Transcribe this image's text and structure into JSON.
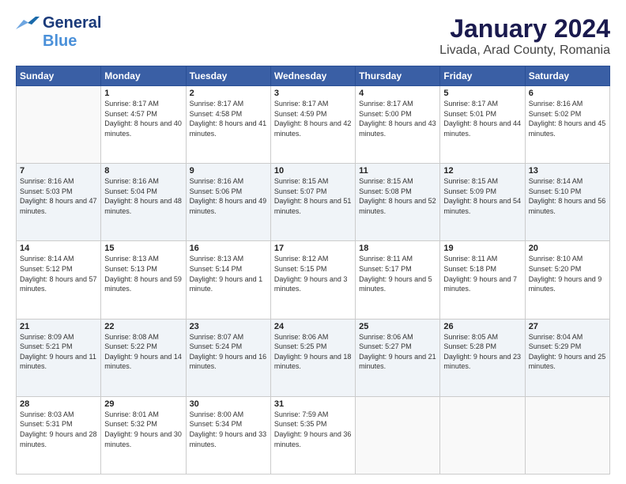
{
  "logo": {
    "line1": "General",
    "line2": "Blue"
  },
  "title": "January 2024",
  "subtitle": "Livada, Arad County, Romania",
  "headers": [
    "Sunday",
    "Monday",
    "Tuesday",
    "Wednesday",
    "Thursday",
    "Friday",
    "Saturday"
  ],
  "weeks": [
    [
      {
        "day": "",
        "sunrise": "",
        "sunset": "",
        "daylight": ""
      },
      {
        "day": "1",
        "sunrise": "Sunrise: 8:17 AM",
        "sunset": "Sunset: 4:57 PM",
        "daylight": "Daylight: 8 hours and 40 minutes."
      },
      {
        "day": "2",
        "sunrise": "Sunrise: 8:17 AM",
        "sunset": "Sunset: 4:58 PM",
        "daylight": "Daylight: 8 hours and 41 minutes."
      },
      {
        "day": "3",
        "sunrise": "Sunrise: 8:17 AM",
        "sunset": "Sunset: 4:59 PM",
        "daylight": "Daylight: 8 hours and 42 minutes."
      },
      {
        "day": "4",
        "sunrise": "Sunrise: 8:17 AM",
        "sunset": "Sunset: 5:00 PM",
        "daylight": "Daylight: 8 hours and 43 minutes."
      },
      {
        "day": "5",
        "sunrise": "Sunrise: 8:17 AM",
        "sunset": "Sunset: 5:01 PM",
        "daylight": "Daylight: 8 hours and 44 minutes."
      },
      {
        "day": "6",
        "sunrise": "Sunrise: 8:16 AM",
        "sunset": "Sunset: 5:02 PM",
        "daylight": "Daylight: 8 hours and 45 minutes."
      }
    ],
    [
      {
        "day": "7",
        "sunrise": "Sunrise: 8:16 AM",
        "sunset": "Sunset: 5:03 PM",
        "daylight": "Daylight: 8 hours and 47 minutes."
      },
      {
        "day": "8",
        "sunrise": "Sunrise: 8:16 AM",
        "sunset": "Sunset: 5:04 PM",
        "daylight": "Daylight: 8 hours and 48 minutes."
      },
      {
        "day": "9",
        "sunrise": "Sunrise: 8:16 AM",
        "sunset": "Sunset: 5:06 PM",
        "daylight": "Daylight: 8 hours and 49 minutes."
      },
      {
        "day": "10",
        "sunrise": "Sunrise: 8:15 AM",
        "sunset": "Sunset: 5:07 PM",
        "daylight": "Daylight: 8 hours and 51 minutes."
      },
      {
        "day": "11",
        "sunrise": "Sunrise: 8:15 AM",
        "sunset": "Sunset: 5:08 PM",
        "daylight": "Daylight: 8 hours and 52 minutes."
      },
      {
        "day": "12",
        "sunrise": "Sunrise: 8:15 AM",
        "sunset": "Sunset: 5:09 PM",
        "daylight": "Daylight: 8 hours and 54 minutes."
      },
      {
        "day": "13",
        "sunrise": "Sunrise: 8:14 AM",
        "sunset": "Sunset: 5:10 PM",
        "daylight": "Daylight: 8 hours and 56 minutes."
      }
    ],
    [
      {
        "day": "14",
        "sunrise": "Sunrise: 8:14 AM",
        "sunset": "Sunset: 5:12 PM",
        "daylight": "Daylight: 8 hours and 57 minutes."
      },
      {
        "day": "15",
        "sunrise": "Sunrise: 8:13 AM",
        "sunset": "Sunset: 5:13 PM",
        "daylight": "Daylight: 8 hours and 59 minutes."
      },
      {
        "day": "16",
        "sunrise": "Sunrise: 8:13 AM",
        "sunset": "Sunset: 5:14 PM",
        "daylight": "Daylight: 9 hours and 1 minute."
      },
      {
        "day": "17",
        "sunrise": "Sunrise: 8:12 AM",
        "sunset": "Sunset: 5:15 PM",
        "daylight": "Daylight: 9 hours and 3 minutes."
      },
      {
        "day": "18",
        "sunrise": "Sunrise: 8:11 AM",
        "sunset": "Sunset: 5:17 PM",
        "daylight": "Daylight: 9 hours and 5 minutes."
      },
      {
        "day": "19",
        "sunrise": "Sunrise: 8:11 AM",
        "sunset": "Sunset: 5:18 PM",
        "daylight": "Daylight: 9 hours and 7 minutes."
      },
      {
        "day": "20",
        "sunrise": "Sunrise: 8:10 AM",
        "sunset": "Sunset: 5:20 PM",
        "daylight": "Daylight: 9 hours and 9 minutes."
      }
    ],
    [
      {
        "day": "21",
        "sunrise": "Sunrise: 8:09 AM",
        "sunset": "Sunset: 5:21 PM",
        "daylight": "Daylight: 9 hours and 11 minutes."
      },
      {
        "day": "22",
        "sunrise": "Sunrise: 8:08 AM",
        "sunset": "Sunset: 5:22 PM",
        "daylight": "Daylight: 9 hours and 14 minutes."
      },
      {
        "day": "23",
        "sunrise": "Sunrise: 8:07 AM",
        "sunset": "Sunset: 5:24 PM",
        "daylight": "Daylight: 9 hours and 16 minutes."
      },
      {
        "day": "24",
        "sunrise": "Sunrise: 8:06 AM",
        "sunset": "Sunset: 5:25 PM",
        "daylight": "Daylight: 9 hours and 18 minutes."
      },
      {
        "day": "25",
        "sunrise": "Sunrise: 8:06 AM",
        "sunset": "Sunset: 5:27 PM",
        "daylight": "Daylight: 9 hours and 21 minutes."
      },
      {
        "day": "26",
        "sunrise": "Sunrise: 8:05 AM",
        "sunset": "Sunset: 5:28 PM",
        "daylight": "Daylight: 9 hours and 23 minutes."
      },
      {
        "day": "27",
        "sunrise": "Sunrise: 8:04 AM",
        "sunset": "Sunset: 5:29 PM",
        "daylight": "Daylight: 9 hours and 25 minutes."
      }
    ],
    [
      {
        "day": "28",
        "sunrise": "Sunrise: 8:03 AM",
        "sunset": "Sunset: 5:31 PM",
        "daylight": "Daylight: 9 hours and 28 minutes."
      },
      {
        "day": "29",
        "sunrise": "Sunrise: 8:01 AM",
        "sunset": "Sunset: 5:32 PM",
        "daylight": "Daylight: 9 hours and 30 minutes."
      },
      {
        "day": "30",
        "sunrise": "Sunrise: 8:00 AM",
        "sunset": "Sunset: 5:34 PM",
        "daylight": "Daylight: 9 hours and 33 minutes."
      },
      {
        "day": "31",
        "sunrise": "Sunrise: 7:59 AM",
        "sunset": "Sunset: 5:35 PM",
        "daylight": "Daylight: 9 hours and 36 minutes."
      },
      {
        "day": "",
        "sunrise": "",
        "sunset": "",
        "daylight": ""
      },
      {
        "day": "",
        "sunrise": "",
        "sunset": "",
        "daylight": ""
      },
      {
        "day": "",
        "sunrise": "",
        "sunset": "",
        "daylight": ""
      }
    ]
  ]
}
